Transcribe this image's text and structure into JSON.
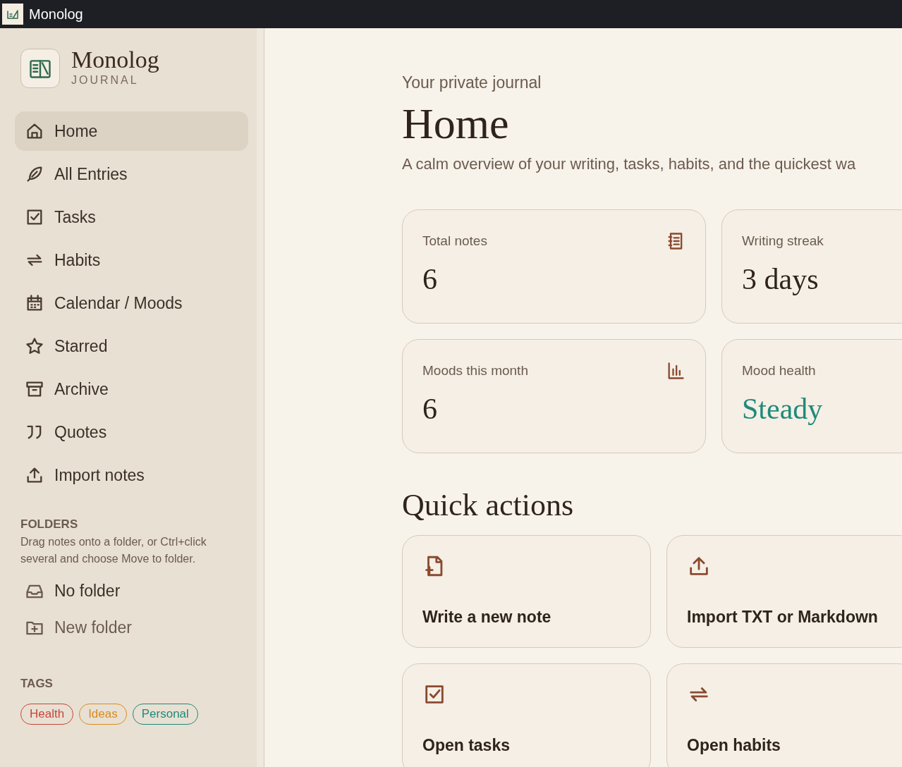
{
  "window": {
    "title": "Monolog"
  },
  "brand": {
    "name": "Monolog",
    "subtitle": "JOURNAL"
  },
  "nav": [
    {
      "label": "Home",
      "selected": true
    },
    {
      "label": "All Entries",
      "selected": false
    },
    {
      "label": "Tasks",
      "selected": false
    },
    {
      "label": "Habits",
      "selected": false
    },
    {
      "label": "Calendar / Moods",
      "selected": false
    },
    {
      "label": "Starred",
      "selected": false
    },
    {
      "label": "Archive",
      "selected": false
    },
    {
      "label": "Quotes",
      "selected": false
    },
    {
      "label": "Import notes",
      "selected": false
    }
  ],
  "folders": {
    "heading": "FOLDERS",
    "hint": "Drag notes onto a folder, or Ctrl+click several and choose Move to folder.",
    "items": [
      {
        "label": "No folder",
        "kind": "folder"
      },
      {
        "label": "New folder",
        "kind": "add"
      }
    ]
  },
  "tags": {
    "heading": "TAGS",
    "items": [
      {
        "label": "Health",
        "color": "#c8453a"
      },
      {
        "label": "Ideas",
        "color": "#d98b1f"
      },
      {
        "label": "Personal",
        "color": "#1f8a7a"
      }
    ]
  },
  "header": {
    "eyebrow": "Your private journal",
    "title": "Home",
    "subtitle": "A calm overview of your writing, tasks, habits, and the quickest wa"
  },
  "stats": [
    {
      "label": "Total notes",
      "value": "6",
      "kind": "notes"
    },
    {
      "label": "Writing streak",
      "value": "3 days",
      "kind": "plain"
    },
    {
      "label": "Moods this month",
      "value": "6",
      "kind": "chart"
    },
    {
      "label": "Mood health",
      "value": "Steady",
      "kind": "plain",
      "color": "#1f8a7a"
    }
  ],
  "quick_actions": {
    "title": "Quick actions",
    "items": [
      {
        "label": "Write a new note",
        "kind": "new"
      },
      {
        "label": "Import TXT or Markdown",
        "kind": "import"
      },
      {
        "label": "Open tasks",
        "kind": "tasks"
      },
      {
        "label": "Open habits",
        "kind": "habits"
      }
    ]
  }
}
